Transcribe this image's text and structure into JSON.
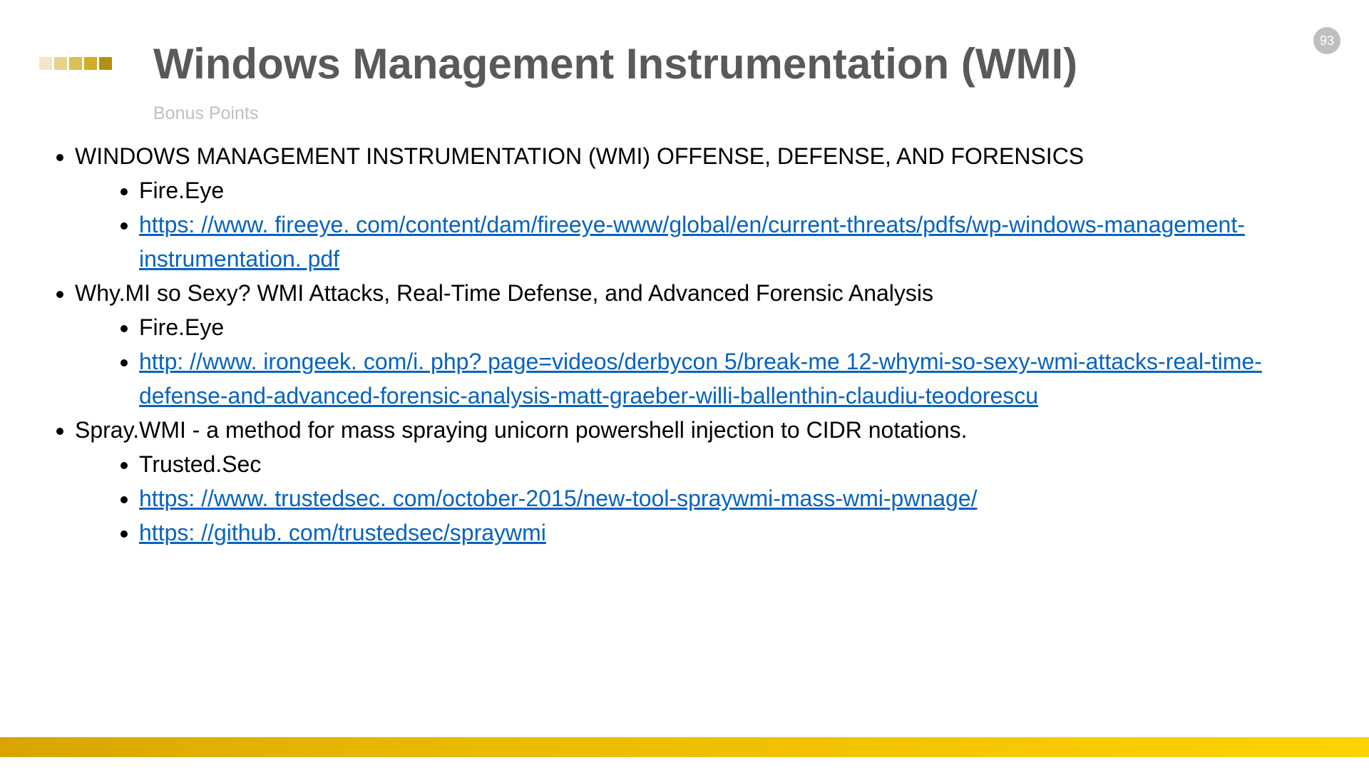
{
  "page_number": "93",
  "deco_colors": [
    "#f2e6c4",
    "#e6d28a",
    "#dcbf52",
    "#d2ad1f",
    "#b38f12"
  ],
  "title": "Windows Management Instrumentation (WMI)",
  "subtitle": "Bonus Points",
  "items": [
    {
      "text": "WINDOWS MANAGEMENT INSTRUMENTATION (WMI) OFFENSE, DEFENSE, AND FORENSICS",
      "sub": [
        {
          "text": "Fire.Eye"
        },
        {
          "link": "https: //www. fireeye. com/content/dam/fireeye-www/global/en/current-threats/pdfs/wp-windows-management-instrumentation. pdf"
        }
      ]
    },
    {
      "text": "Why.MI so Sexy? WMI Attacks, Real-Time Defense, and Advanced Forensic Analysis",
      "sub": [
        {
          "text": "Fire.Eye"
        },
        {
          "link": "http: //www. irongeek. com/i. php? page=videos/derbycon 5/break-me 12-whymi-so-sexy-wmi-attacks-real-time-defense-and-advanced-forensic-analysis-matt-graeber-willi-ballenthin-claudiu-teodorescu"
        }
      ]
    },
    {
      "text": "Spray.WMI - a method for mass spraying unicorn powershell injection to CIDR notations.",
      "sub": [
        {
          "text": "Trusted.Sec"
        },
        {
          "link": "https: //www. trustedsec. com/october-2015/new-tool-spraywmi-mass-wmi-pwnage/"
        },
        {
          "link": "https: //github. com/trustedsec/spraywmi"
        }
      ]
    }
  ]
}
